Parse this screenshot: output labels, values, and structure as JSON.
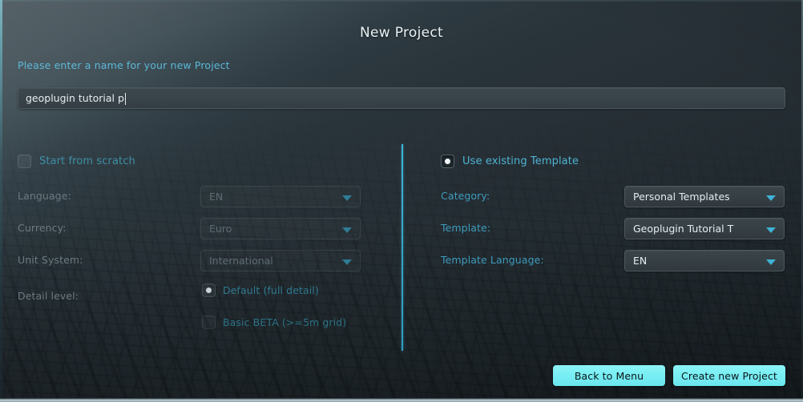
{
  "window": {
    "title": "New Project"
  },
  "project_name": {
    "prompt": "Please enter a name for your new Project",
    "value": "geoplugin tutorial p",
    "placeholder": ""
  },
  "left_panel": {
    "mode_label": "Start from scratch",
    "enabled": false,
    "fields": [
      {
        "label": "Language:",
        "value": "EN"
      },
      {
        "label": "Currency:",
        "value": "Euro"
      },
      {
        "label": "Unit System:",
        "value": "International"
      }
    ],
    "detail_level": {
      "label": "Detail level:",
      "options": [
        {
          "label": "Default (full detail)",
          "selected": true
        },
        {
          "label": "Basic BETA (>=5m grid)",
          "selected": false
        }
      ]
    }
  },
  "right_panel": {
    "mode_label": "Use existing Template",
    "enabled": true,
    "fields": [
      {
        "label": "Category:",
        "value": "Personal Templates"
      },
      {
        "label": "Template:",
        "value": "Geoplugin Tutorial T"
      },
      {
        "label": "Template Language:",
        "value": "EN"
      }
    ]
  },
  "buttons": {
    "back": "Back to Menu",
    "create": "Create new Project"
  },
  "colors": {
    "accent_cyan": "#4fb4d4",
    "button_cyan": "#79eff4",
    "divider_cyan": "#35a6c8",
    "disabled_label": "#6d7a80",
    "background_dark": "#2b3539"
  }
}
